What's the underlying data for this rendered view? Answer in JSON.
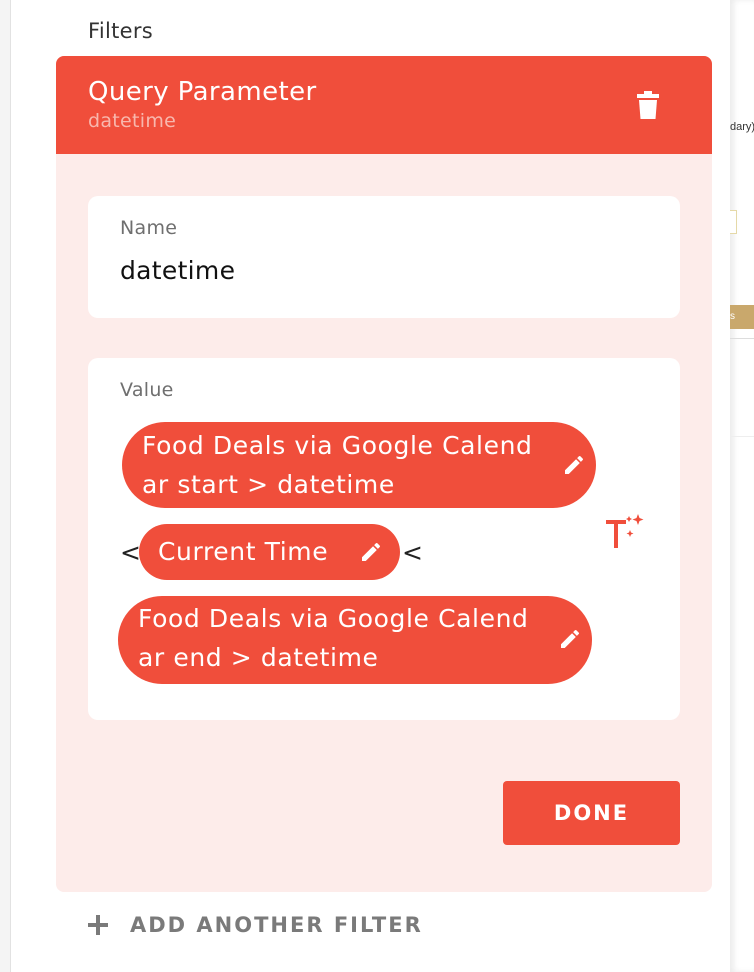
{
  "filters": {
    "title": "Filters"
  },
  "query_parameter": {
    "title": "Query Parameter",
    "subtitle": "datetime",
    "name_label": "Name",
    "name_value": "datetime",
    "value_label": "Value",
    "value_tokens": [
      {
        "type": "pill",
        "label": "Food Deals via Google Calend\nar start > datetime"
      },
      {
        "type": "operator",
        "label": "<"
      },
      {
        "type": "pill",
        "label": "Current Time"
      },
      {
        "type": "operator",
        "label": "<"
      },
      {
        "type": "pill",
        "label": "Food Deals via Google Calend\nar end > datetime"
      }
    ],
    "done_label": "DONE"
  },
  "add_filter": {
    "label": "ADD ANOTHER FILTER"
  },
  "background": {
    "right_panel_text": "dary)",
    "right_panel_bar_text": "s"
  },
  "icons": {
    "delete": "trash-icon",
    "edit": "pencil-icon",
    "magic": "magic-text-icon",
    "add": "plus-icon"
  },
  "colors": {
    "accent": "#f04e3b",
    "card_background": "#fdecea",
    "subtitle": "#f8b7ad"
  }
}
